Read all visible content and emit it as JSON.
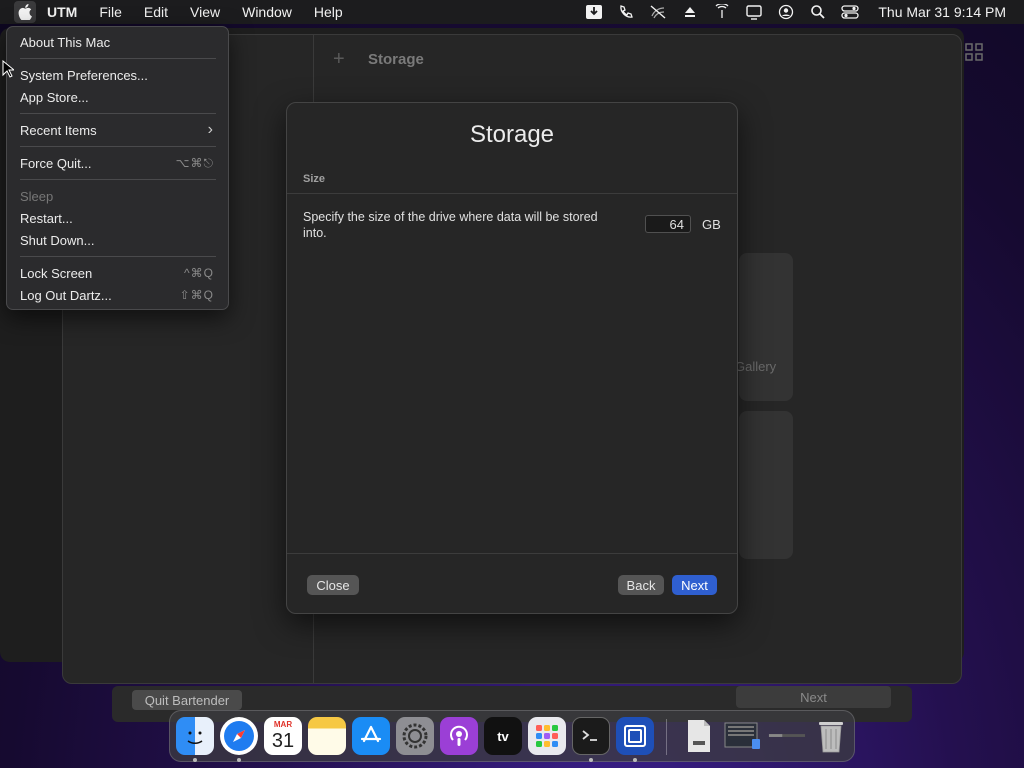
{
  "menubar": {
    "app_name": "UTM",
    "menus": [
      "File",
      "Edit",
      "View",
      "Window",
      "Help"
    ],
    "clock": "Thu Mar 31  9:14 PM"
  },
  "apple_menu": {
    "items": [
      {
        "label": "About This Mac",
        "shortcut": ""
      },
      {
        "label": "System Preferences...",
        "shortcut": ""
      },
      {
        "label": "App Store...",
        "shortcut": ""
      },
      {
        "label": "Recent Items",
        "shortcut": "›"
      },
      {
        "label": "Force Quit...",
        "shortcut": "⌥⌘⎋"
      },
      {
        "label": "Sleep",
        "shortcut": ""
      },
      {
        "label": "Restart...",
        "shortcut": ""
      },
      {
        "label": "Shut Down...",
        "shortcut": ""
      },
      {
        "label": "Lock Screen",
        "shortcut": "^⌘Q"
      },
      {
        "label": "Log Out Dartz...",
        "shortcut": "⇧⌘Q"
      }
    ]
  },
  "utm_window": {
    "toolbar_title": "Storage",
    "gallery_text": "Gallery"
  },
  "sheet": {
    "title": "Storage",
    "section": "Size",
    "description": "Specify the size of the drive where data will be stored into.",
    "size_value": "64",
    "size_unit": "GB",
    "close_label": "Close",
    "back_label": "Back",
    "next_label": "Next"
  },
  "bartender": {
    "quit_label": "Quit Bartender",
    "next_label": "Next"
  },
  "dock": {
    "calendar_month": "MAR",
    "calendar_day": "31",
    "tv_label": "tv"
  },
  "colors": {
    "accent": "#2f5fd0",
    "sheet_bg": "#262626",
    "menu_bg": "#2b2b2d"
  }
}
